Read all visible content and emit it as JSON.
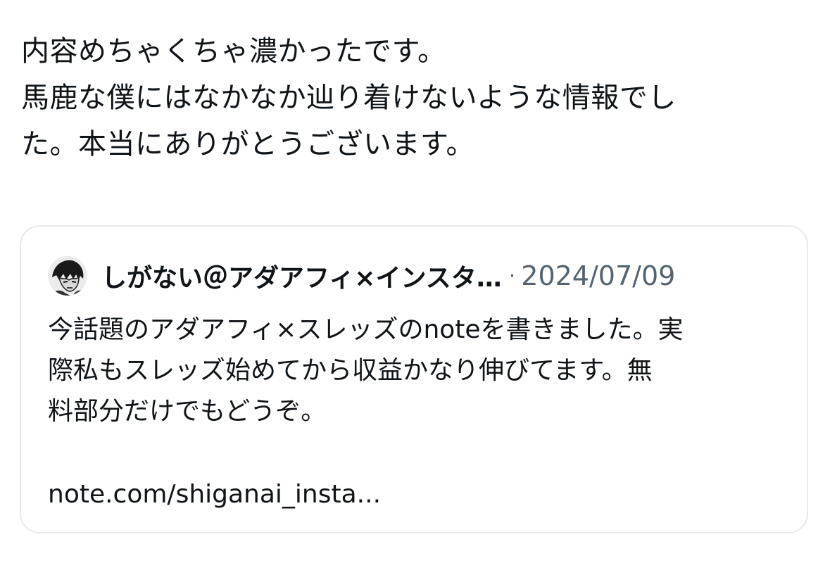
{
  "post": {
    "lines": [
      "内容めちゃくちゃ濃かったです。",
      "馬鹿な僕にはなかなか辿り着けないような情報でし",
      "た。本当にありがとうございます。"
    ]
  },
  "quote": {
    "avatar_icon": "manga-character-avatar-icon",
    "author": "しがない＠アダアフィ×インスタ…",
    "separator": "·",
    "date": "2024/07/09",
    "body_lines": [
      "今話題のアダアフィ×スレッズのnoteを書きました。実",
      "際私もスレッズ始めてから収益かなり伸びてます。無",
      "料部分だけでもどうぞ。"
    ],
    "link": "note.com/shiganai_insta..."
  }
}
